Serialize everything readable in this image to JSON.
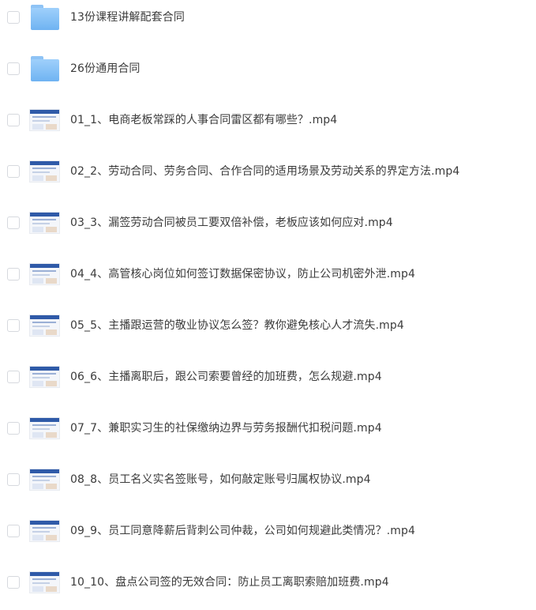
{
  "files": [
    {
      "type": "folder",
      "icon": "folder-icon",
      "name": "13份课程讲解配套合同"
    },
    {
      "type": "folder",
      "icon": "folder-icon",
      "name": "26份通用合同"
    },
    {
      "type": "video",
      "icon": "video-thumbnail-icon",
      "name": "01_1、电商老板常踩的人事合同雷区都有哪些？.mp4"
    },
    {
      "type": "video",
      "icon": "video-thumbnail-icon",
      "name": "02_2、劳动合同、劳务合同、合作合同的适用场景及劳动关系的界定方法.mp4"
    },
    {
      "type": "video",
      "icon": "video-thumbnail-icon",
      "name": "03_3、漏签劳动合同被员工要双倍补偿，老板应该如何应对.mp4"
    },
    {
      "type": "video",
      "icon": "video-thumbnail-icon",
      "name": "04_4、高管核心岗位如何签订数据保密协议，防止公司机密外泄.mp4"
    },
    {
      "type": "video",
      "icon": "video-thumbnail-icon",
      "name": "05_5、主播跟运营的敬业协议怎么签？教你避免核心人才流失.mp4"
    },
    {
      "type": "video",
      "icon": "video-thumbnail-icon",
      "name": "06_6、主播离职后，跟公司索要曾经的加班费，怎么规避.mp4"
    },
    {
      "type": "video",
      "icon": "video-thumbnail-icon",
      "name": "07_7、兼职实习生的社保缴纳边界与劳务报酬代扣税问题.mp4"
    },
    {
      "type": "video",
      "icon": "video-thumbnail-icon",
      "name": "08_8、员工名义实名签账号，如何敲定账号归属权协议.mp4"
    },
    {
      "type": "video",
      "icon": "video-thumbnail-icon",
      "name": "09_9、员工同意降薪后背刺公司仲裁，公司如何规避此类情况？.mp4"
    },
    {
      "type": "video",
      "icon": "video-thumbnail-icon",
      "name": "10_10、盘点公司签的无效合同：防止员工离职索赔加班费.mp4"
    }
  ]
}
